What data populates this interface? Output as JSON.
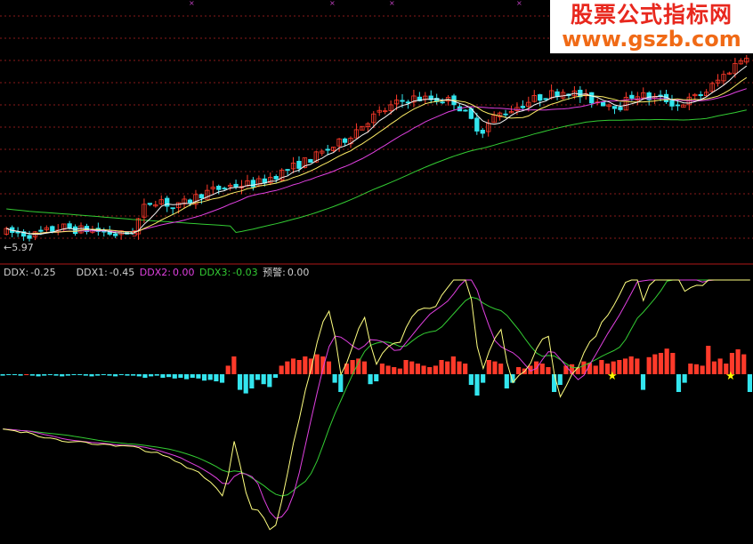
{
  "watermark": {
    "line1": "股票公式指标网",
    "line2": "www.gszb.com"
  },
  "price_panel": {
    "low_marker": "←5.97",
    "signal_marker": "S"
  },
  "indicator_legend": {
    "ddx_label": "DDX:",
    "ddx_value": "-0.25",
    "ddx1_label": "DDX1:",
    "ddx1_value": "-0.45",
    "ddx2_label": "DDX2:",
    "ddx2_value": "0.00",
    "ddx3_label": "DDX3:",
    "ddx3_value": "-0.03",
    "warn_label": "预警:",
    "warn_value": "0.00"
  },
  "colors": {
    "background": "#000000",
    "up": "#ff3a2a",
    "down": "#33e5ee",
    "ma5": "#f5f5f5",
    "ma10": "#ffee66",
    "ma20": "#e040e0",
    "ma60": "#33cc33",
    "gridline": "#8a1a1a",
    "ddx_text": "#d0d0d0",
    "ddx2": "#e040e0",
    "ddx3": "#33cc33",
    "ddx1_line": "#ffff80",
    "star": "#ffff00"
  },
  "chart_data": [
    {
      "type": "candlestick",
      "title": "",
      "low_price_label": "5.97",
      "bars": 130,
      "trend_anchors": [
        [
          0,
          6.1
        ],
        [
          10,
          6.0
        ],
        [
          20,
          6.3
        ],
        [
          25,
          6.2
        ],
        [
          30,
          6.2
        ],
        [
          40,
          6.0
        ],
        [
          45,
          6.1
        ],
        [
          50,
          7.2
        ],
        [
          55,
          7.4
        ],
        [
          60,
          7.0
        ],
        [
          70,
          7.6
        ],
        [
          80,
          7.9
        ],
        [
          90,
          8.0
        ],
        [
          100,
          8.5
        ],
        [
          110,
          9.0
        ],
        [
          120,
          9.6
        ],
        [
          130,
          10.5
        ],
        [
          140,
          11.1
        ],
        [
          145,
          11.3
        ],
        [
          160,
          11.2
        ],
        [
          170,
          10.0
        ],
        [
          175,
          10.6
        ],
        [
          190,
          11.3
        ],
        [
          200,
          11.6
        ],
        [
          210,
          11.2
        ],
        [
          220,
          11.0
        ],
        [
          225,
          11.5
        ],
        [
          230,
          11.3
        ],
        [
          235,
          11.3
        ],
        [
          240,
          11.0
        ],
        [
          250,
          11.5
        ],
        [
          260,
          12.5
        ],
        [
          265,
          13.0
        ]
      ],
      "moving_averages": [
        "MA5",
        "MA10",
        "MA20",
        "MA60"
      ]
    },
    {
      "type": "bar",
      "title": "",
      "series": [
        {
          "name": "DDX",
          "values": [
            -0.02,
            -0.01,
            -0.01,
            -0.02,
            0.0,
            -0.02,
            -0.03,
            -0.02,
            -0.01,
            -0.02,
            -0.03,
            -0.02,
            -0.01,
            -0.01,
            -0.02,
            -0.03,
            -0.02,
            -0.01,
            -0.02,
            -0.03,
            -0.01,
            -0.02,
            -0.02,
            -0.03,
            -0.05,
            -0.03,
            -0.02,
            -0.05,
            -0.04,
            -0.06,
            -0.05,
            -0.07,
            -0.05,
            -0.06,
            -0.09,
            -0.08,
            -0.1,
            -0.12,
            0.12,
            0.25,
            -0.22,
            -0.27,
            -0.2,
            -0.08,
            -0.14,
            -0.18,
            -0.05,
            0.12,
            0.18,
            0.22,
            0.2,
            0.25,
            0.22,
            0.28,
            0.25,
            0.18,
            -0.12,
            -0.25,
            0.15,
            0.2,
            0.22,
            0.18,
            -0.14,
            -0.1,
            0.15,
            0.12,
            0.1,
            0.08,
            0.2,
            0.18,
            0.15,
            0.12,
            0.1,
            0.12,
            0.2,
            0.18,
            0.25,
            0.18,
            0.15,
            -0.15,
            -0.3,
            -0.12,
            0.2,
            0.18,
            0.15,
            -0.2,
            -0.12,
            0.1,
            0.08,
            0.12,
            0.18,
            0.15,
            0.1,
            -0.25,
            -0.15,
            0.12,
            0.14,
            0.1,
            0.18,
            0.16,
            0.12,
            0.2,
            0.15,
            0.18,
            0.2,
            0.22,
            0.25,
            0.22,
            -0.22,
            0.24,
            0.28,
            0.3,
            0.36,
            0.3,
            -0.25,
            -0.12,
            0.15,
            0.14,
            0.12,
            0.4,
            0.18,
            0.22,
            0.15,
            0.3,
            0.35,
            0.28,
            -0.25
          ]
        },
        {
          "name": "DDX1",
          "values": []
        },
        {
          "name": "DDX2",
          "values": []
        },
        {
          "name": "DDX3",
          "values": []
        }
      ]
    }
  ]
}
